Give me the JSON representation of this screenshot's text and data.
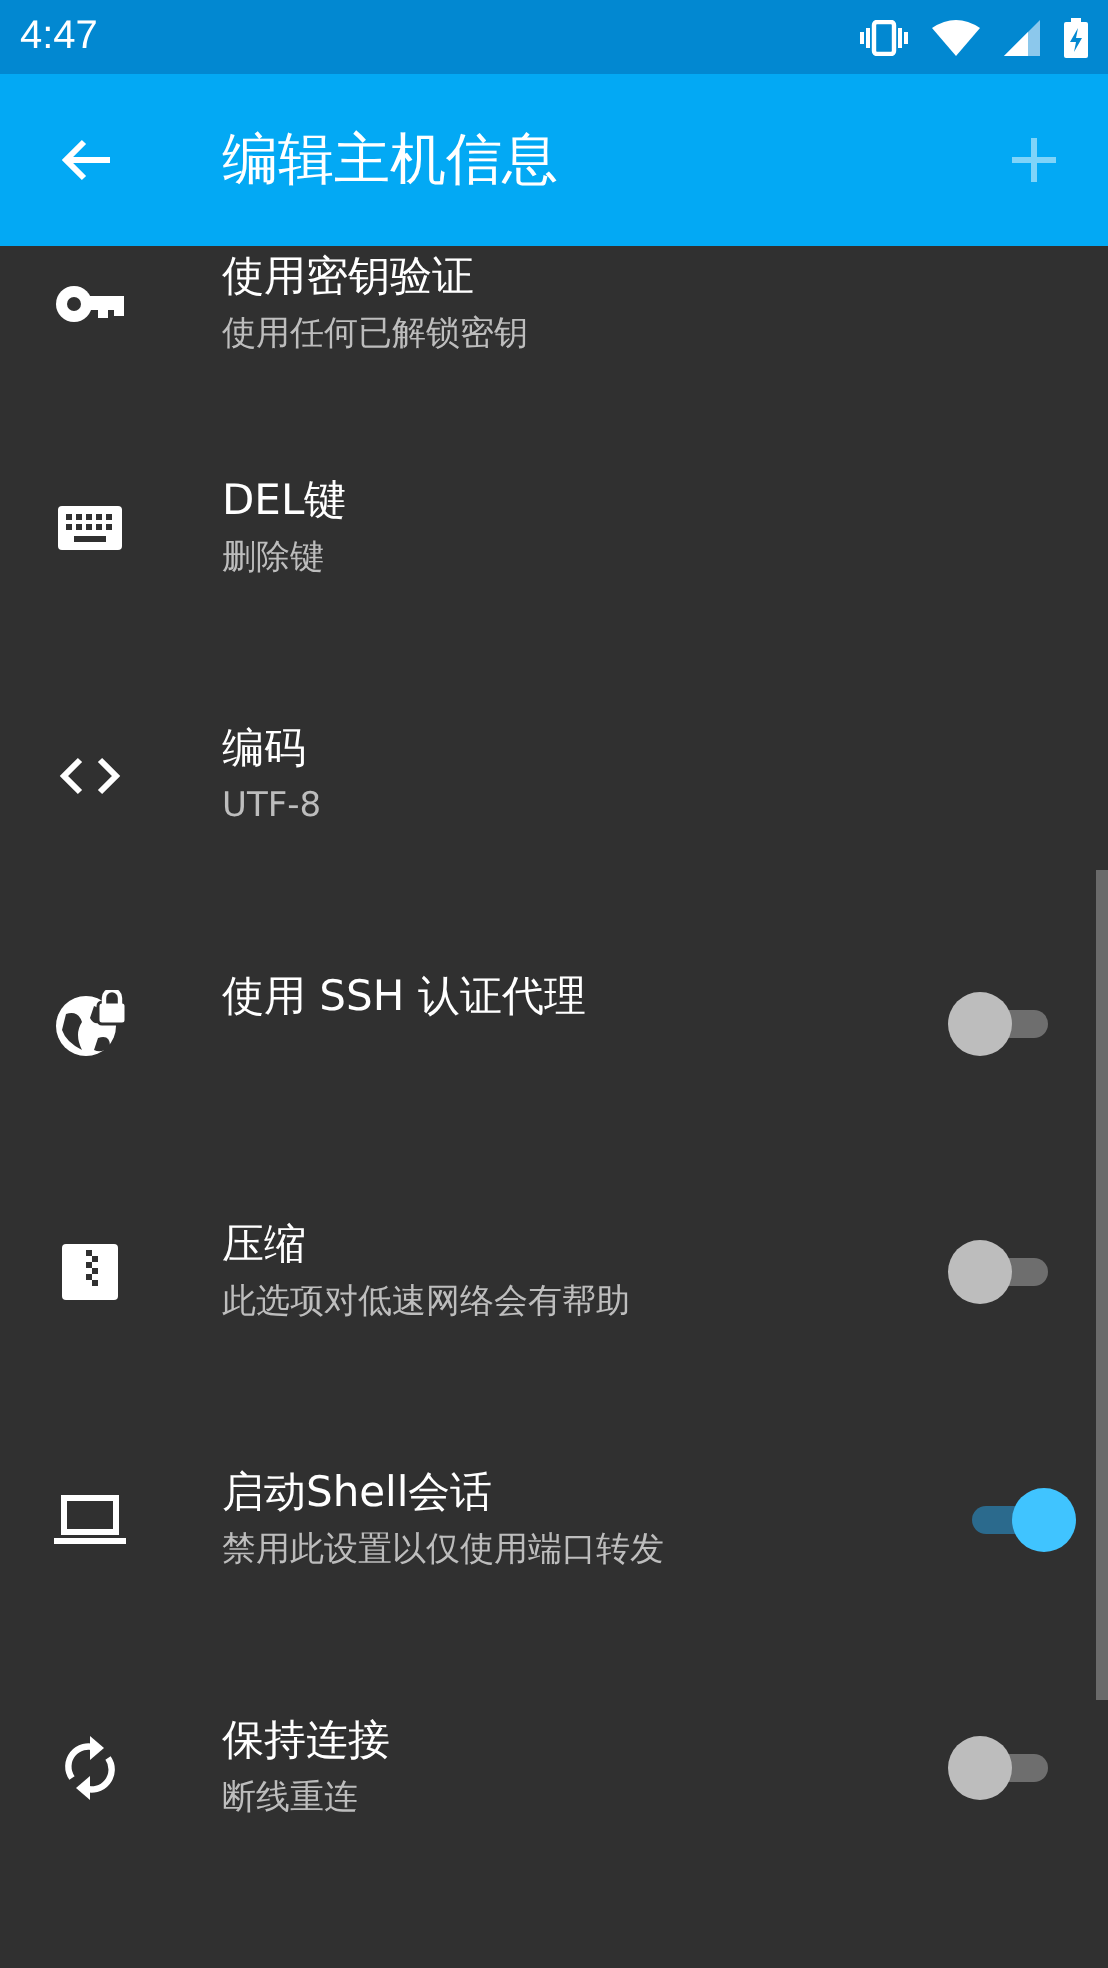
{
  "status_bar": {
    "time": "4:47"
  },
  "app_bar": {
    "title": "编辑主机信息"
  },
  "settings": [
    {
      "kind": "link",
      "title": "使用密钥验证",
      "subtitle": "使用任何已解锁密钥"
    },
    {
      "kind": "link",
      "title": "DEL键",
      "subtitle": "删除键"
    },
    {
      "kind": "link",
      "title": "编码",
      "subtitle": "UTF-8"
    },
    {
      "kind": "toggle",
      "title": "使用 SSH 认证代理",
      "on": false
    },
    {
      "kind": "toggle",
      "title": "压缩",
      "subtitle": "此选项对低速网络会有帮助",
      "on": false
    },
    {
      "kind": "toggle",
      "title": "启动Shell会话",
      "subtitle": "禁用此设置以仅使用端口转发",
      "on": true
    },
    {
      "kind": "toggle",
      "title": "保持连接",
      "subtitle": "断线重连",
      "on": false
    }
  ]
}
